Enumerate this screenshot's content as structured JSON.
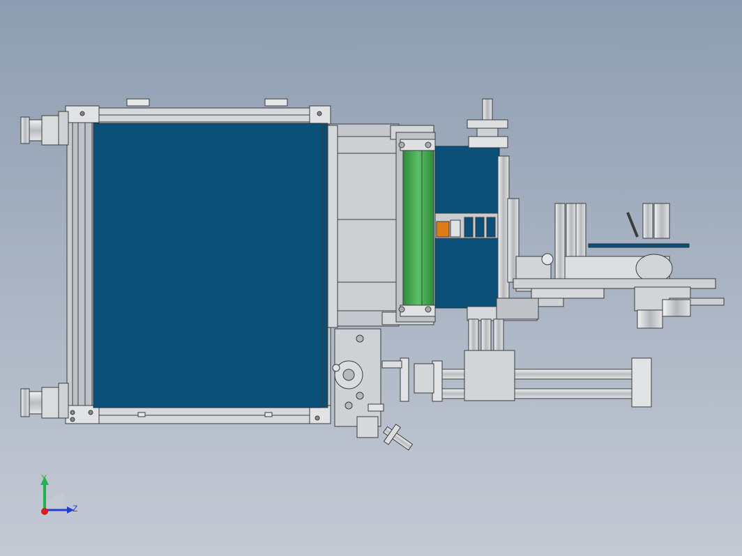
{
  "viewport": {
    "background_top": "#8e9db1",
    "background_bottom": "#c4cad4"
  },
  "model": {
    "panel_color": "#0a5078",
    "roller_color": "#3fa14b",
    "accent_color": "#e07b1a",
    "frame_color": "#c9cccf"
  },
  "triad": {
    "y_label": "Y",
    "z_label": "Z",
    "y_color": "#22b14c",
    "z_color": "#1f3fd0",
    "x_color": "#d02020"
  }
}
